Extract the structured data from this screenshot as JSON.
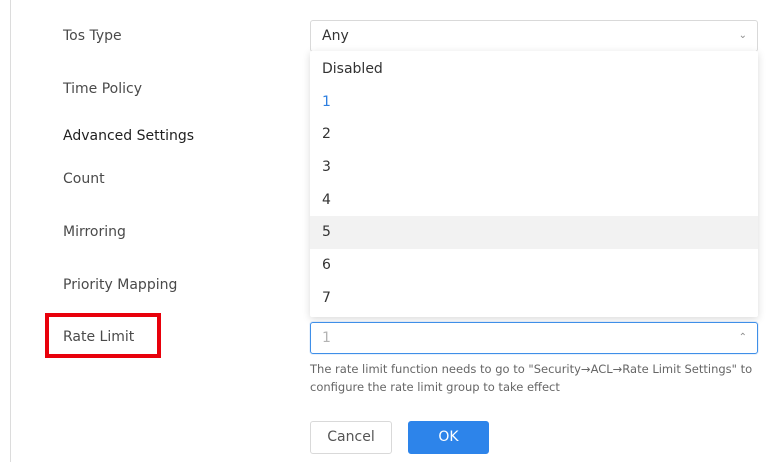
{
  "form": {
    "tos_type_label": "Tos Type",
    "tos_type_value": "Any",
    "time_policy_label": "Time Policy",
    "advanced_settings_label": "Advanced Settings",
    "count_label": "Count",
    "mirroring_label": "Mirroring",
    "priority_mapping_label": "Priority Mapping",
    "rate_limit_label": "Rate Limit",
    "rate_limit_value": "1",
    "rate_limit_hint": "The rate limit function needs to go to \"Security→ACL→Rate Limit Settings\" to configure the rate limit group to take effect"
  },
  "dropdown": {
    "options": [
      "Disabled",
      "1",
      "2",
      "3",
      "4",
      "5",
      "6",
      "7"
    ],
    "selected": "1",
    "hovered": "5"
  },
  "buttons": {
    "cancel": "Cancel",
    "ok": "OK"
  },
  "icons": {
    "select_closed": "chevron-down-icon",
    "select_open": "chevron-up-icon"
  },
  "colors": {
    "primary": "#2d84ea",
    "highlight_box": "#e8000b",
    "selected_option": "#2d7fe0"
  }
}
